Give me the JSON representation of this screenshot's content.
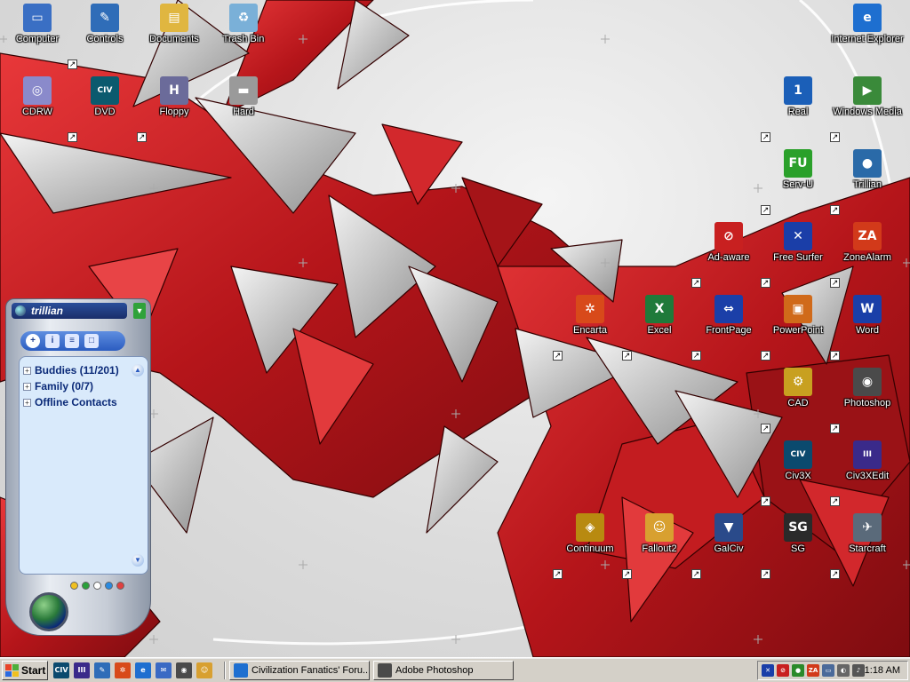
{
  "desktop": {
    "icons": [
      {
        "id": "computer",
        "label": "Computer",
        "icon": "computer-icon",
        "color": "#3a6fc4",
        "glyph": "▭"
      },
      {
        "id": "controls",
        "label": "Controls",
        "icon": "control-panel-icon",
        "color": "#2f6db8",
        "glyph": "✎"
      },
      {
        "id": "documents",
        "label": "Documents",
        "icon": "folder-icon",
        "color": "#e0b640",
        "glyph": "▤"
      },
      {
        "id": "trash",
        "label": "Trash Bin",
        "icon": "recycle-bin-icon",
        "color": "#7ab0d8",
        "glyph": "♻"
      },
      {
        "id": "ie",
        "label": "Internet Explorer",
        "icon": "internet-explorer-icon",
        "color": "#1e6fd0",
        "glyph": "e"
      },
      {
        "id": "cdrw",
        "label": "CDRW",
        "icon": "cd-drive-icon",
        "color": "#8a8acb",
        "glyph": "◎"
      },
      {
        "id": "dvd",
        "label": "DVD",
        "icon": "civ3-dvd-icon",
        "color": "#0b5a6e",
        "glyph": "CIV"
      },
      {
        "id": "floppy",
        "label": "Floppy",
        "icon": "floppy-drive-icon",
        "color": "#6b6b9a",
        "glyph": "H"
      },
      {
        "id": "hard",
        "label": "Hard",
        "icon": "hard-drive-icon",
        "color": "#9a9a9a",
        "glyph": "▬"
      },
      {
        "id": "real",
        "label": "Real",
        "icon": "realplayer-icon",
        "color": "#1b5fb8",
        "glyph": "1"
      },
      {
        "id": "wmp",
        "label": "Windows Media",
        "icon": "windows-media-player-icon",
        "color": "#3a8a3a",
        "glyph": "▶"
      },
      {
        "id": "servu",
        "label": "Serv-U",
        "icon": "serv-u-icon",
        "color": "#2aa02a",
        "glyph": "FU"
      },
      {
        "id": "trillian",
        "label": "Trillian",
        "icon": "trillian-icon",
        "color": "#2a6aa8",
        "glyph": "●"
      },
      {
        "id": "adaware",
        "label": "Ad-aware",
        "icon": "ad-aware-icon",
        "color": "#c82020",
        "glyph": "⊘"
      },
      {
        "id": "freesurfer",
        "label": "Free Surfer",
        "icon": "free-surfer-icon",
        "color": "#1a3ea8",
        "glyph": "✕"
      },
      {
        "id": "zonealarm",
        "label": "ZoneAlarm",
        "icon": "zonealarm-icon",
        "color": "#d23a1a",
        "glyph": "ZA"
      },
      {
        "id": "encarta",
        "label": "Encarta",
        "icon": "encarta-icon",
        "color": "#d84a1a",
        "glyph": "✲"
      },
      {
        "id": "excel",
        "label": "Excel",
        "icon": "excel-icon",
        "color": "#1f7a3a",
        "glyph": "X"
      },
      {
        "id": "frontpage",
        "label": "FrontPage",
        "icon": "frontpage-icon",
        "color": "#1b3fa8",
        "glyph": "⇔"
      },
      {
        "id": "powerpoint",
        "label": "PowerPoint",
        "icon": "powerpoint-icon",
        "color": "#d06a1a",
        "glyph": "▣"
      },
      {
        "id": "word",
        "label": "Word",
        "icon": "word-icon",
        "color": "#1a3fa8",
        "glyph": "W"
      },
      {
        "id": "cad",
        "label": "CAD",
        "icon": "cad-icon",
        "color": "#c8a020",
        "glyph": "⚙"
      },
      {
        "id": "photoshop",
        "label": "Photoshop",
        "icon": "photoshop-icon",
        "color": "#4a4a4a",
        "glyph": "◉"
      },
      {
        "id": "civ3",
        "label": "Civ3X",
        "icon": "civ3-icon",
        "color": "#0b4a6e",
        "glyph": "CIV"
      },
      {
        "id": "civ3xedit",
        "label": "Civ3XEdit",
        "icon": "civ3-editor-icon",
        "color": "#3a2a8a",
        "glyph": "III"
      },
      {
        "id": "continuum",
        "label": "Continuum",
        "icon": "continuum-icon",
        "color": "#b88a10",
        "glyph": "◈"
      },
      {
        "id": "fallout2",
        "label": "Fallout2",
        "icon": "fallout2-icon",
        "color": "#d8a030",
        "glyph": "☺"
      },
      {
        "id": "galciv",
        "label": "GalCiv",
        "icon": "galciv-icon",
        "color": "#2a4a8a",
        "glyph": "▼"
      },
      {
        "id": "sg",
        "label": "SG",
        "icon": "sg-icon",
        "color": "#2a2a2a",
        "glyph": "SG"
      },
      {
        "id": "starcraft",
        "label": "Starcraft",
        "icon": "starcraft-icon",
        "color": "#5a6a7a",
        "glyph": "✈"
      }
    ]
  },
  "trillian": {
    "title": "trillian",
    "toolbar": [
      {
        "icon": "add-contact-icon",
        "glyph": "+"
      },
      {
        "icon": "info-icon",
        "glyph": "i"
      },
      {
        "icon": "status-icon",
        "glyph": "≡"
      },
      {
        "icon": "window-icon",
        "glyph": "□"
      }
    ],
    "groups": [
      {
        "label": "Buddies (11/201)"
      },
      {
        "label": "Family (0/7)"
      },
      {
        "label": "Offline Contacts"
      }
    ],
    "status_dots": [
      "#f0c020",
      "#2aa03a",
      "#ffffff",
      "#2a8ae0",
      "#e04040"
    ]
  },
  "taskbar": {
    "start_label": "Start",
    "quicklaunch": [
      {
        "icon": "civ3-icon",
        "color": "#0b4a6e",
        "glyph": "CIV"
      },
      {
        "icon": "civ3-editor-icon",
        "color": "#3a2a8a",
        "glyph": "III"
      },
      {
        "icon": "control-panel-icon",
        "color": "#2f6db8",
        "glyph": "✎"
      },
      {
        "icon": "encarta-icon",
        "color": "#d84a1a",
        "glyph": "✲"
      },
      {
        "icon": "internet-explorer-icon",
        "color": "#1e6fd0",
        "glyph": "e"
      },
      {
        "icon": "outlook-icon",
        "color": "#3a6ac4",
        "glyph": "✉"
      },
      {
        "icon": "photoshop-icon",
        "color": "#4a4a4a",
        "glyph": "◉"
      },
      {
        "icon": "fallout2-icon",
        "color": "#d8a030",
        "glyph": "☺"
      }
    ],
    "tasks": [
      {
        "label": "Civilization Fanatics' Foru...",
        "icon": "internet-explorer-icon",
        "color": "#1e6fd0"
      },
      {
        "label": "Adobe Photoshop",
        "icon": "photoshop-icon",
        "color": "#4a4a4a"
      }
    ],
    "tray_icons": [
      {
        "icon": "free-surfer-icon",
        "color": "#1a3ea8",
        "glyph": "✕"
      },
      {
        "icon": "ad-aware-icon",
        "color": "#c82020",
        "glyph": "⊘"
      },
      {
        "icon": "network-icon",
        "color": "#2a8a2a",
        "glyph": "●"
      },
      {
        "icon": "zonealarm-icon",
        "color": "#d23a1a",
        "glyph": "ZA"
      },
      {
        "icon": "display-icon",
        "color": "#4a6a9a",
        "glyph": "▭"
      },
      {
        "icon": "volume-icon",
        "color": "#666666",
        "glyph": "◐"
      },
      {
        "icon": "speaker-icon",
        "color": "#555555",
        "glyph": "♪"
      }
    ],
    "clock": "1:18 AM"
  }
}
